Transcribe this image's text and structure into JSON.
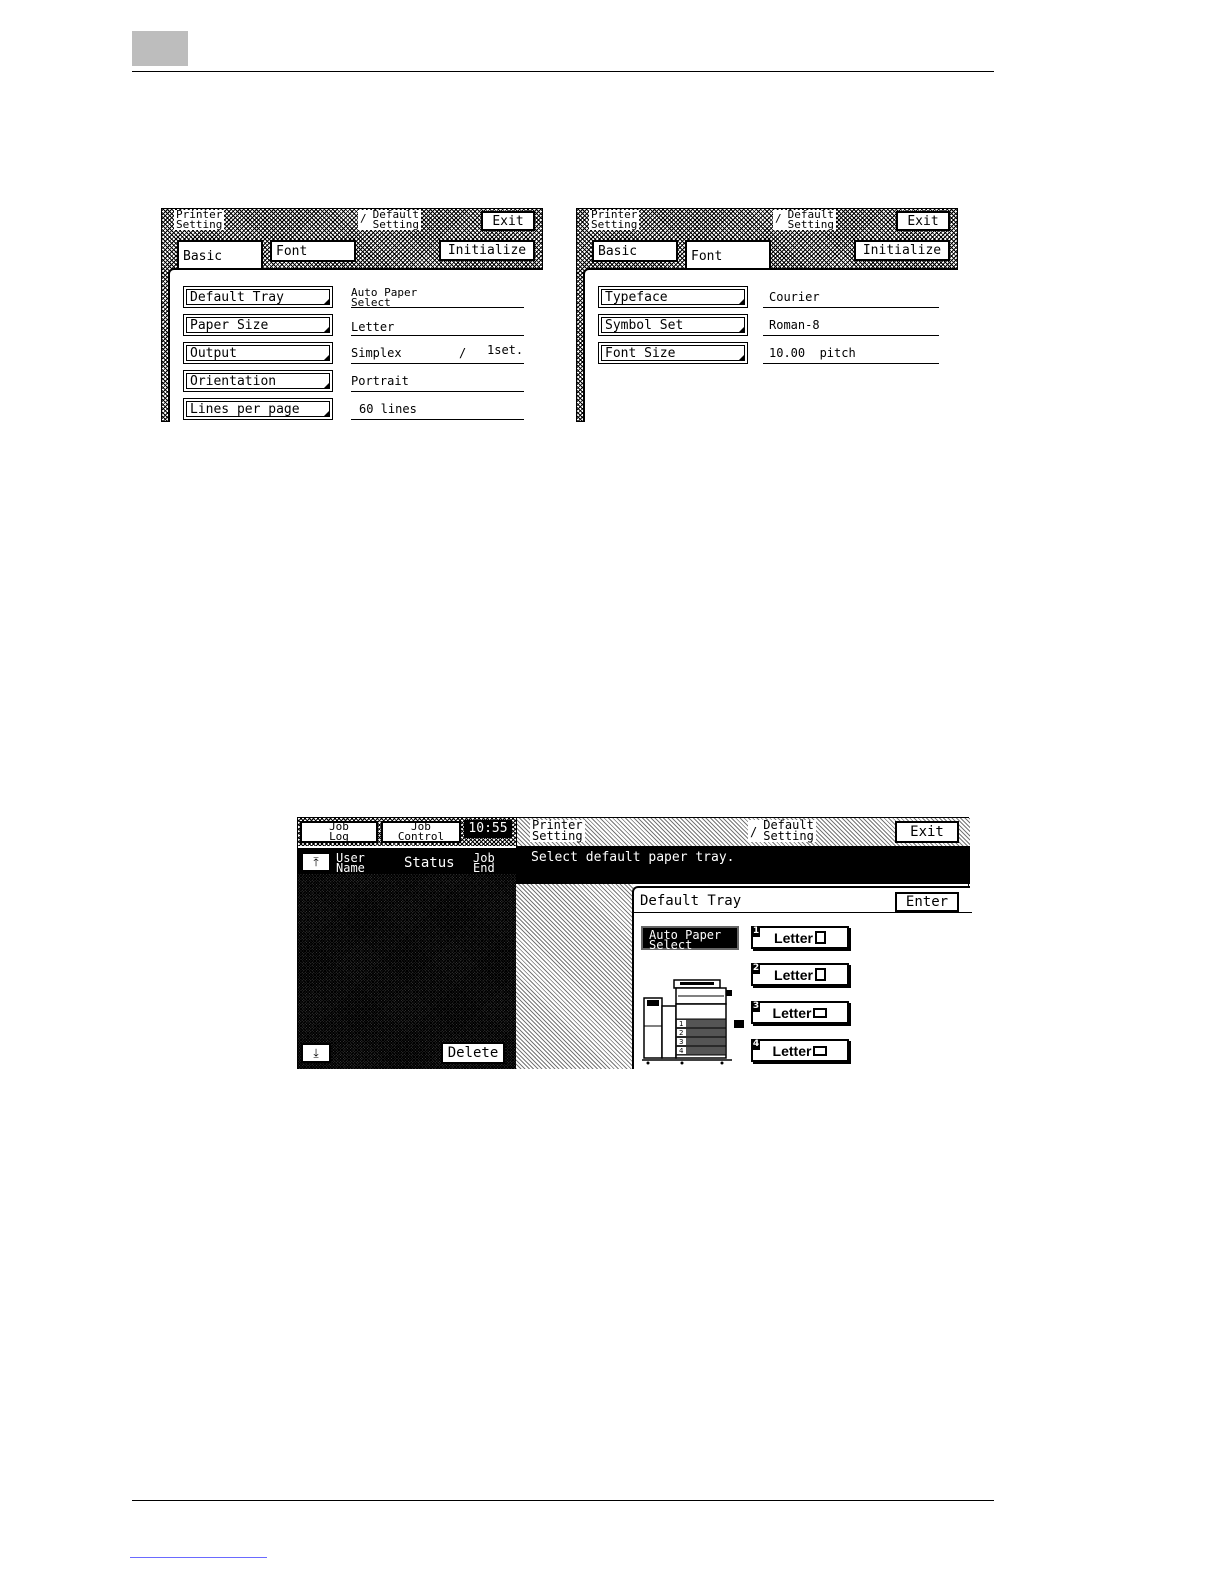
{
  "panel_basic": {
    "header_left": [
      "Printer",
      "Setting"
    ],
    "header_sep": "/",
    "header_right": [
      "Default",
      "Setting"
    ],
    "exit": "Exit",
    "tab_basic": "Basic",
    "tab_font": "Font",
    "initialize": "Initialize",
    "rows": [
      {
        "label": "Default Tray",
        "value": "Auto Paper Select"
      },
      {
        "label": "Paper Size",
        "value": "Letter"
      },
      {
        "label": "Output",
        "value": "Simplex",
        "sep": "/",
        "extra": "1set."
      },
      {
        "label": "Orientation",
        "value": "Portrait"
      },
      {
        "label": "Lines per page",
        "value": "60 lines"
      }
    ]
  },
  "panel_font": {
    "header_left": [
      "Printer",
      "Setting"
    ],
    "header_sep": "/",
    "header_right": [
      "Default",
      "Setting"
    ],
    "exit": "Exit",
    "tab_basic": "Basic",
    "tab_font": "Font",
    "initialize": "Initialize",
    "rows": [
      {
        "label": "Typeface",
        "value": "Courier"
      },
      {
        "label": "Symbol Set",
        "value": "Roman-8"
      },
      {
        "label": "Font Size",
        "value": "10.00  pitch"
      }
    ]
  },
  "tray_screen": {
    "job_log": [
      "Job",
      "Log"
    ],
    "job_control": [
      "Job",
      "Control"
    ],
    "time": "10:55",
    "header_left": [
      "Printer",
      "Setting"
    ],
    "header_sep": "/",
    "header_right": [
      "Default",
      "Setting"
    ],
    "exit": "Exit",
    "col_user": [
      "User",
      "Name"
    ],
    "col_status": "Status",
    "col_jobend": [
      "Job",
      "End"
    ],
    "message": "Select default paper tray.",
    "delete": "Delete",
    "dialog_title": "Default Tray",
    "enter": "Enter",
    "auto_paper": [
      "Auto Paper",
      "Select"
    ],
    "trays": [
      {
        "number": "1",
        "label": "Letter"
      },
      {
        "number": "2",
        "label": "Letter"
      },
      {
        "number": "3",
        "label": "Letter"
      },
      {
        "number": "4",
        "label": "Letter"
      }
    ],
    "machine_tray_numbers": [
      "1",
      "2",
      "3",
      "4"
    ]
  },
  "icons": [
    "scroll-top-icon",
    "scroll-bottom-icon",
    "portrait-paper-icon",
    "landscape-paper-icon",
    "copier-machine-icon"
  ]
}
